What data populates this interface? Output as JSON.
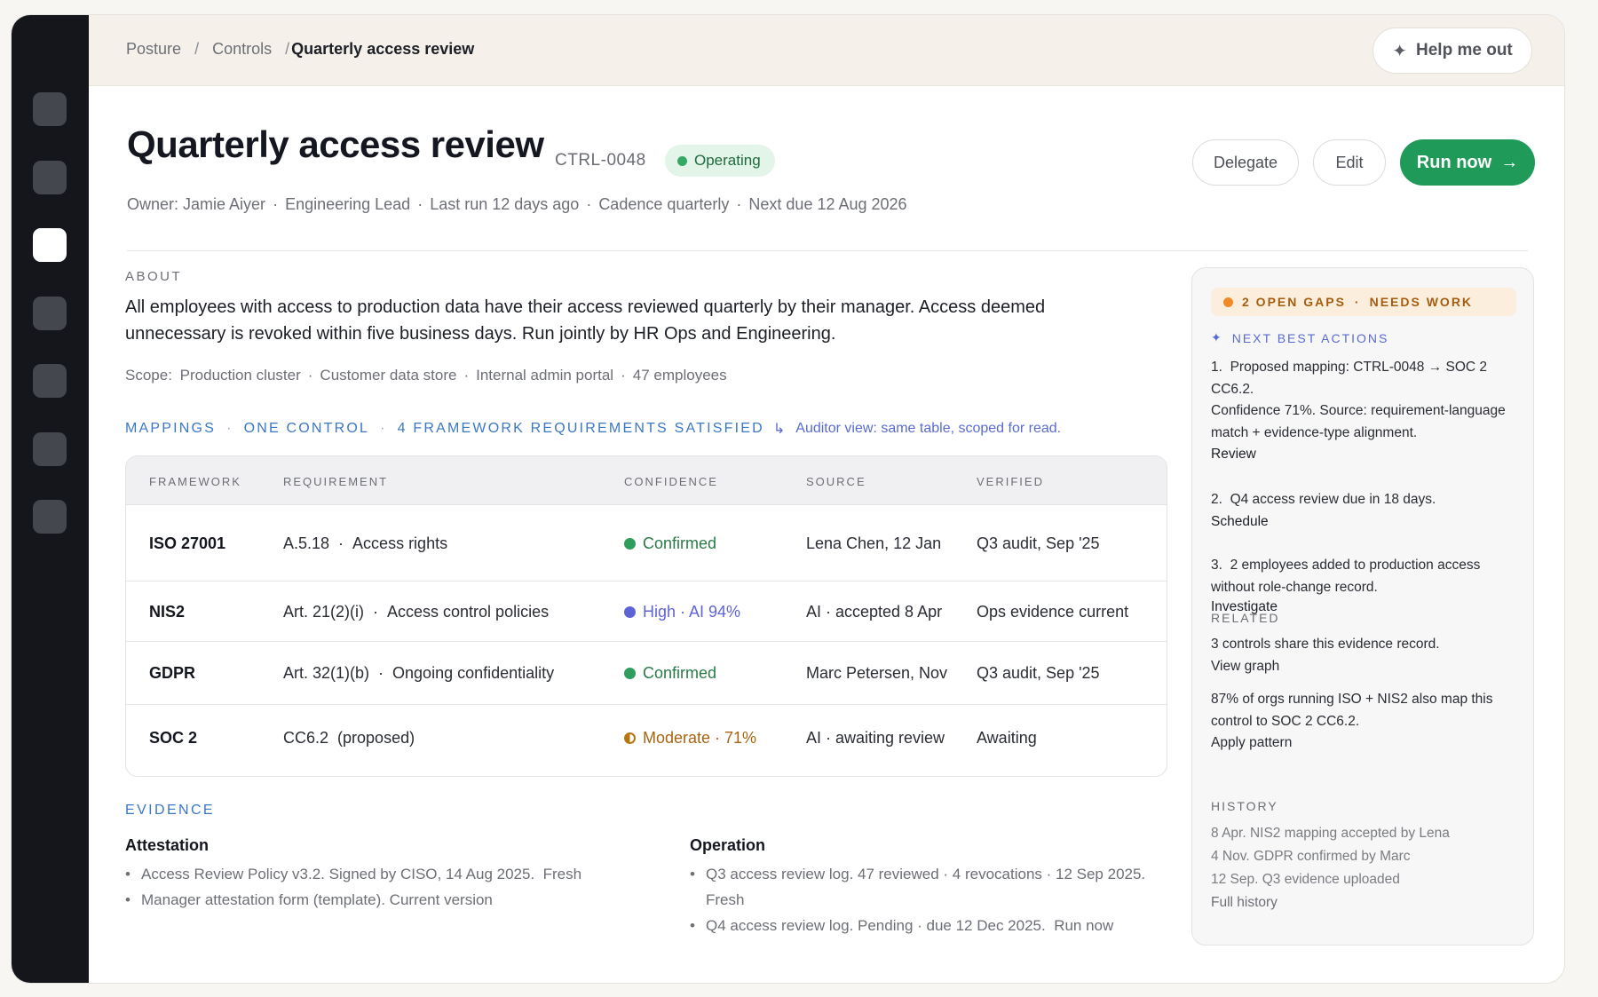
{
  "breadcrumb": {
    "items": [
      "Posture",
      "Controls"
    ],
    "separator": "/",
    "current": "Quarterly access review"
  },
  "help_button": {
    "label": "Help me out",
    "icon": "sparkle-icon"
  },
  "sidebar": {
    "item_count": 7,
    "active_index": 2
  },
  "header": {
    "title": "Quarterly access review",
    "control_id": "CTRL-0048",
    "status": "Operating",
    "status_color": "#34a865",
    "meta": {
      "owner": "Owner: Jamie Aiyer",
      "role": "Engineering Lead",
      "last_run": "Last run 12 days ago",
      "cadence": "Cadence quarterly",
      "next_due": "Next due 12 Aug 2026"
    },
    "actions": {
      "delegate": "Delegate",
      "edit": "Edit",
      "run_now": "Run now",
      "run_now_icon": "arrow-right-icon"
    }
  },
  "about": {
    "label": "ABOUT",
    "text": "All employees with access to production data have their access reviewed quarterly by their manager. Access deemed unnecessary is revoked within five business days. Run jointly by HR Ops and Engineering.",
    "scope_label": "Scope:",
    "scope_items": [
      "Production cluster",
      "Customer data store",
      "Internal admin portal",
      "47 employees"
    ]
  },
  "mappings": {
    "label": "MAPPINGS",
    "one_control": "ONE CONTROL",
    "satisfied": "4 FRAMEWORK REQUIREMENTS SATISFIED",
    "hook_icon": "↳",
    "auditor_view": "Auditor view: same table, scoped for read.",
    "columns": [
      "FRAMEWORK",
      "REQUIREMENT",
      "CONFIDENCE",
      "SOURCE",
      "VERIFIED"
    ],
    "rows": [
      {
        "framework": "ISO 27001",
        "req_code": "A.5.18",
        "req_name": "Access rights",
        "confidence": "Confirmed",
        "conf_type": "green",
        "source": "Lena Chen, 12 Jan",
        "verified": "Q3 audit, Sep '25"
      },
      {
        "framework": "NIS2",
        "req_code": "Art. 21(2)(i)",
        "req_name": "Access control policies",
        "confidence": "High · AI 94%",
        "conf_type": "purple",
        "source": "AI · accepted 8 Apr",
        "verified": "Ops evidence current"
      },
      {
        "framework": "GDPR",
        "req_code": "Art. 32(1)(b)",
        "req_name": "Ongoing confidentiality",
        "confidence": "Confirmed",
        "conf_type": "green",
        "source": "Marc Petersen, Nov",
        "verified": "Q3 audit, Sep '25"
      },
      {
        "framework": "SOC 2",
        "req_code": "CC6.2",
        "req_name": "(proposed)",
        "confidence": "Moderate · 71%",
        "conf_type": "orange",
        "source": "AI · awaiting review",
        "verified": "Awaiting"
      }
    ],
    "colors": {
      "green": "#2f9d5c",
      "purple": "#5e63d6",
      "orange": "#b8740f"
    }
  },
  "evidence": {
    "label": "EVIDENCE",
    "attestation": {
      "title": "Attestation",
      "items": [
        {
          "text": "Access Review Policy v3.2. Signed by CISO, 14 Aug 2025.",
          "tag": "Fresh"
        },
        {
          "text": "Manager attestation form (template). Current version",
          "tag": ""
        }
      ]
    },
    "operation": {
      "title": "Operation",
      "items": [
        {
          "text": "Q3 access review log. 47 reviewed · 4 revocations · 12 Sep 2025.",
          "tag": "Fresh"
        },
        {
          "text": "Q4 access review log. Pending · due 12 Dec 2025.",
          "tag": "Run now"
        }
      ]
    }
  },
  "side_panel": {
    "gaps_badge": "2 OPEN GAPS",
    "gaps_status": "NEEDS WORK",
    "nba_label": "NEXT BEST ACTIONS",
    "nba_icon": "sparkle-icon",
    "actions": [
      {
        "num": "1.",
        "text": "Proposed mapping: CTRL-0048 → SOC 2 CC6.2.",
        "detail": "Confidence 71%. Source: requirement-language match + evidence-type alignment.",
        "cta": "Review"
      },
      {
        "num": "2.",
        "text": "Q4 access review due in 18 days.",
        "detail": "",
        "cta": "Schedule"
      },
      {
        "num": "3.",
        "text": "2 employees added to production access without role-change record.",
        "detail": "",
        "cta": "Investigate"
      }
    ],
    "related_label": "RELATED",
    "related_1_text": "3 controls share this evidence record.",
    "related_1_link": "View graph",
    "related_2_text": "87% of orgs running ISO + NIS2 also map this control to SOC 2 CC6.2.",
    "related_2_link": "Apply pattern",
    "history_label": "HISTORY",
    "history": [
      "8 Apr. NIS2 mapping accepted by Lena",
      "4 Nov. GDPR confirmed by Marc",
      "12 Sep. Q3 evidence uploaded"
    ],
    "history_link": "Full history"
  }
}
